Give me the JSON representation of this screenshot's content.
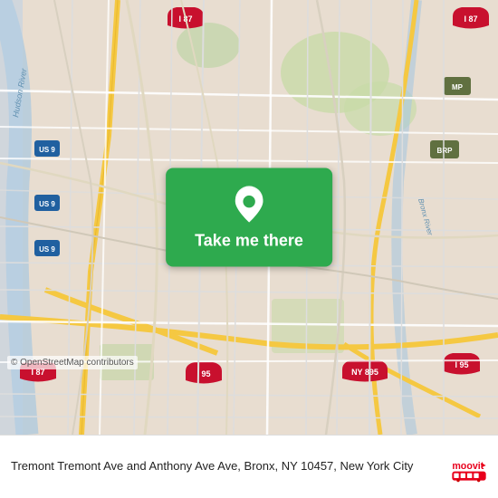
{
  "map": {
    "background_color": "#e8ddd0",
    "copyright": "© OpenStreetMap contributors"
  },
  "button": {
    "label": "Take me there",
    "bg_color": "#2eaa4e"
  },
  "info": {
    "address": "Tremont Tremont Ave and Anthony Ave Ave, Bronx, NY 10457, New York City"
  },
  "branding": {
    "name": "moovit",
    "color": "#e8001c"
  }
}
